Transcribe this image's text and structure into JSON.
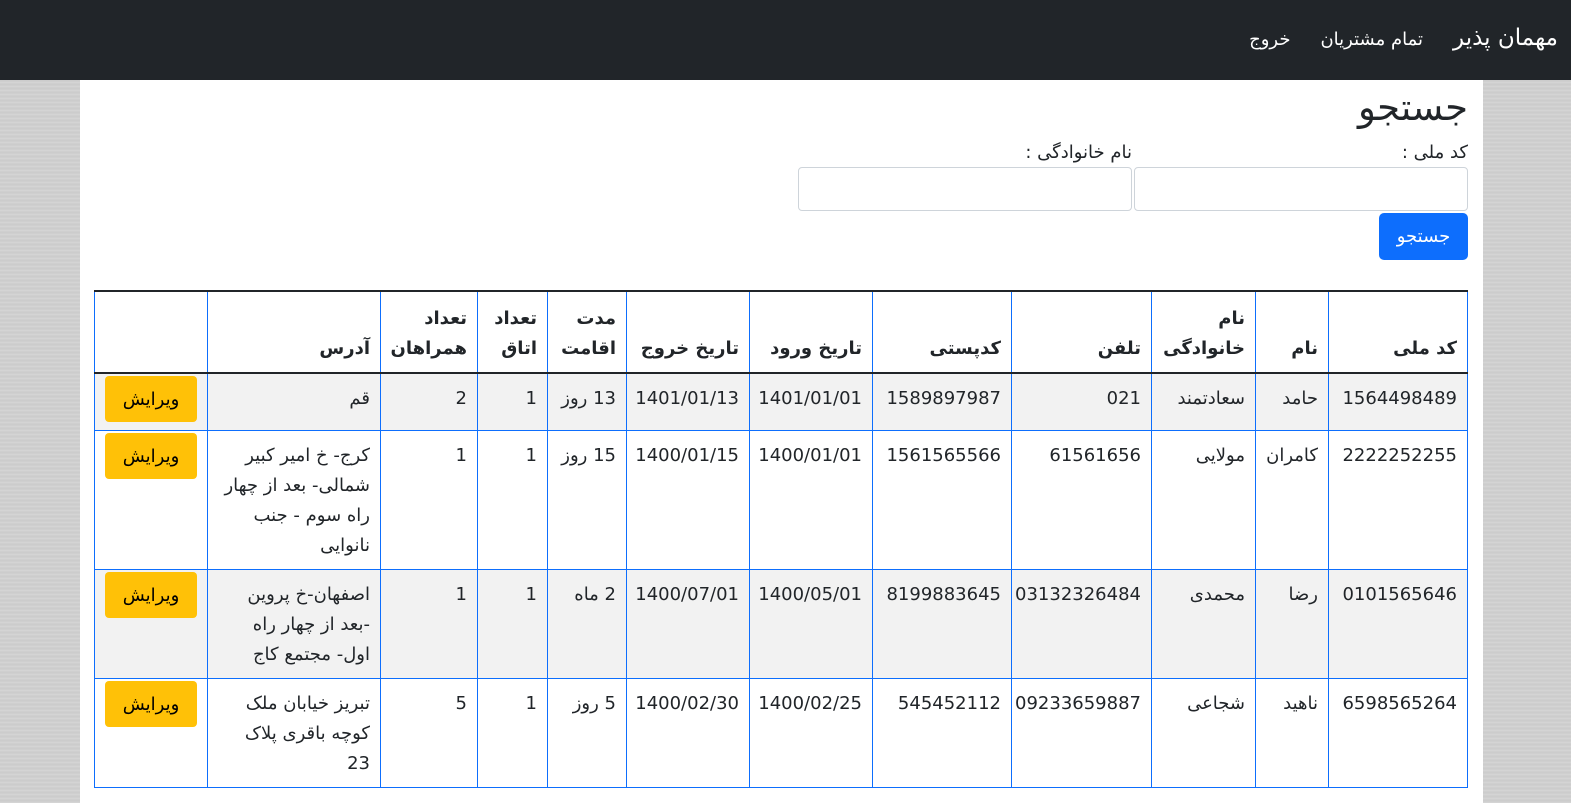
{
  "navbar": {
    "brand": "مهمان پذیر",
    "links": [
      "تمام مشتریان",
      "خروج"
    ]
  },
  "search": {
    "title": "جستجو",
    "national_code_label": "کد ملی :",
    "national_code_value": "",
    "family_name_label": "نام خانوادگی :",
    "family_name_value": "",
    "button_label": "جستجو"
  },
  "table": {
    "headers": [
      "کد ملی",
      "نام",
      "نام خانوادگی",
      "تلفن",
      "کدپستی",
      "تاریخ ورود",
      "تاریخ خروج",
      "مدت اقامت",
      "تعداد اتاق",
      "تعداد همراهان",
      "آدرس",
      ""
    ],
    "rows": [
      [
        "1564498489",
        "حامد",
        "سعادتمند",
        "021",
        "1589897987",
        "1401/01/01",
        "1401/01/13",
        "13 روز",
        "1",
        "2",
        "قم",
        "ویرایش"
      ],
      [
        "2222252255",
        "کامران",
        "مولایی",
        "61561656",
        "1561565566",
        "1400/01/01",
        "1400/01/15",
        "15 روز",
        "1",
        "1",
        "کرج- خ امیر کبیر شمالی- بعد از چهار راه سوم - جنب نانوایی",
        "ویرایش"
      ],
      [
        "0101565646",
        "رضا",
        "محمدی",
        "03132326484",
        "8199883645",
        "1400/05/01",
        "1400/07/01",
        "2 ماه",
        "1",
        "1",
        "اصفهان-خ پروین -بعد از چهار راه اول- مجتمع کاج",
        "ویرایش"
      ],
      [
        "6598565264",
        "ناهید",
        "شجاعی",
        "09233659887",
        "545452112",
        "1400/02/25",
        "1400/02/30",
        "5 روز",
        "1",
        "5",
        "تبریز خیابان ملک کوچه باقری پلاک 23",
        "ویرایش"
      ]
    ]
  },
  "colors": {
    "navbar_bg": "#212529",
    "primary": "#0d6efd",
    "warning": "#ffc107",
    "stripe": "#f2f2f2"
  }
}
